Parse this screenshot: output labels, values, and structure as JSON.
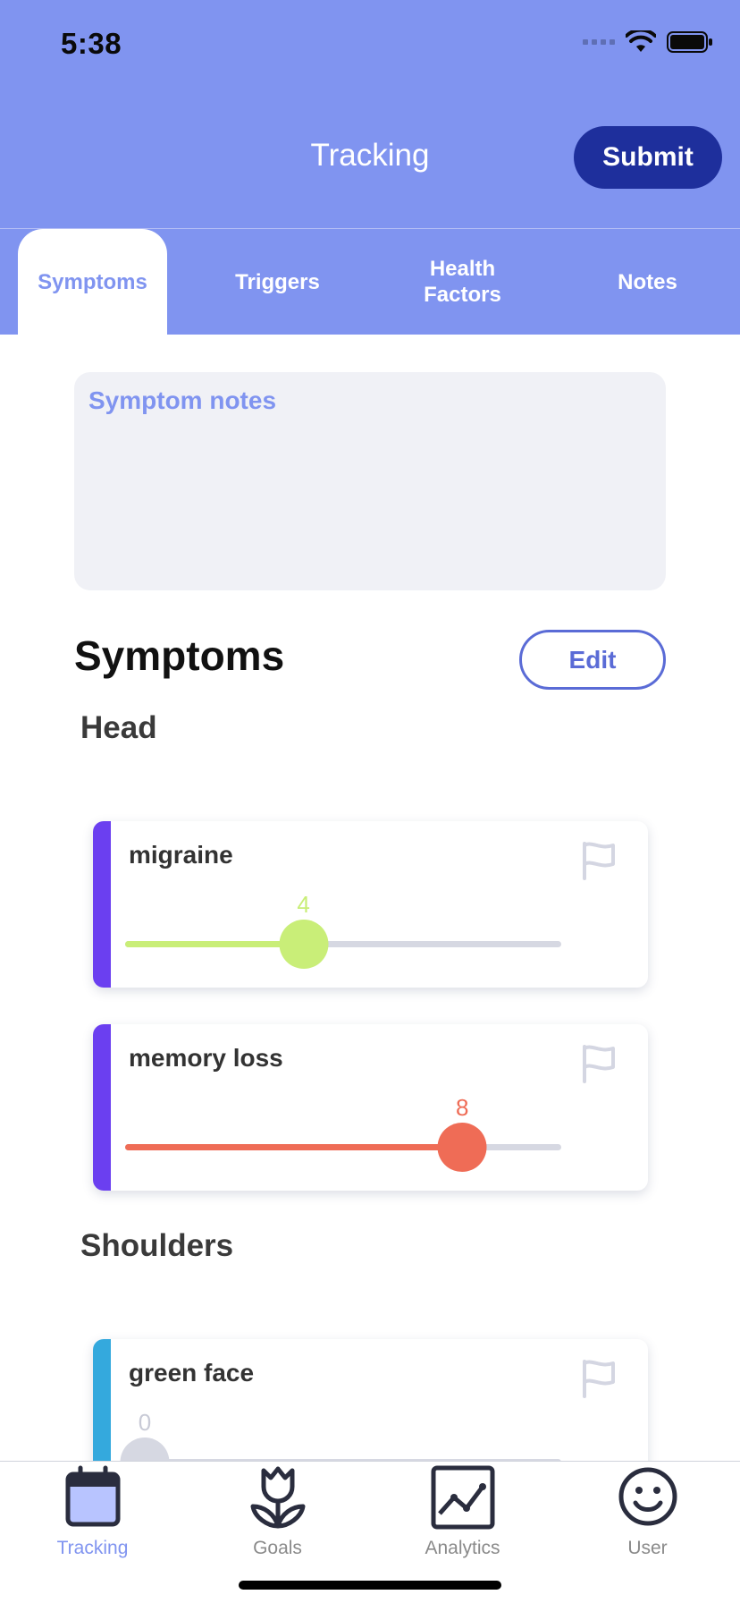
{
  "status_bar": {
    "time": "5:38",
    "icons": [
      "cellular-signal-icon",
      "wifi-icon",
      "battery-icon"
    ]
  },
  "header": {
    "title": "Tracking",
    "submit_label": "Submit",
    "background_color": "#8094f0",
    "submit_color": "#1e2f9c"
  },
  "tabs": [
    {
      "label": "Symptoms",
      "active": true
    },
    {
      "label": "Triggers",
      "active": false
    },
    {
      "label": "Health Factors",
      "active": false
    },
    {
      "label": "Notes",
      "active": false
    }
  ],
  "notes": {
    "placeholder": "Symptom notes"
  },
  "symptoms_section": {
    "title": "Symptoms",
    "edit_label": "Edit",
    "groups": [
      {
        "label": "Head",
        "items": [
          {
            "name": "migraine",
            "value": "4",
            "level": 4,
            "max": 10,
            "bar_color": "#6b3ff0",
            "slider_color": "#c9ee78",
            "flag_icon": "flag-icon"
          },
          {
            "name": "memory loss",
            "value": "8",
            "level": 8,
            "max": 10,
            "bar_color": "#6b3ff0",
            "slider_color": "#ef6c56",
            "flag_icon": "flag-icon"
          }
        ]
      },
      {
        "label": "Shoulders",
        "items": [
          {
            "name": "green face",
            "value": "0",
            "level": 0,
            "max": 10,
            "bar_color": "#34a9dd",
            "slider_color": "#d6d8e2",
            "flag_icon": "flag-icon"
          }
        ]
      }
    ]
  },
  "tabbar": {
    "items": [
      {
        "label": "Tracking",
        "icon": "calendar-icon",
        "active": true
      },
      {
        "label": "Goals",
        "icon": "tulip-icon",
        "active": false
      },
      {
        "label": "Analytics",
        "icon": "line-chart-icon",
        "active": false
      },
      {
        "label": "User",
        "icon": "smiley-face-icon",
        "active": false
      }
    ],
    "active_color": "#8094f0"
  }
}
